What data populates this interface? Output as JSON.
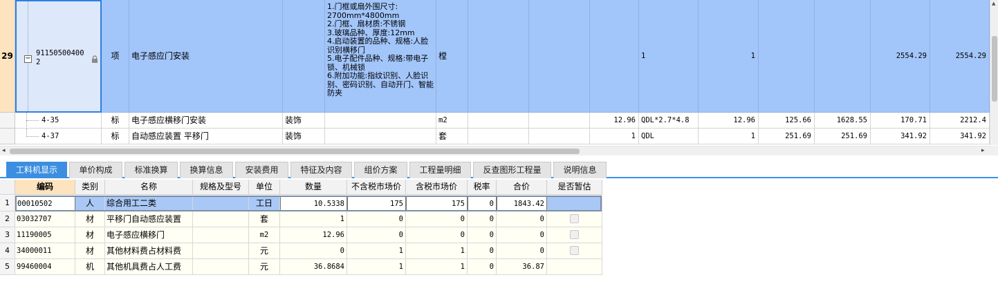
{
  "top_grid": {
    "rows": [
      {
        "row_num": "29",
        "code": "91150500400\n2",
        "type": "项",
        "name": "电子感应门安装",
        "profession": "",
        "features": "1.门框或扇外围尺寸:\n2700mm*4800mm\n2.门框、扇材质:不锈钢\n3.玻璃品种、厚度:12mm\n4.启动装置的品种、规格:人脸识别横移门\n5.电子配件品种、规格:带电子锁、机械锁\n6.附加功能:指纹识别、人脸识别、密码识别、自动开门、智能防夹",
        "unit": "樘",
        "qty_expr": "",
        "qty_unit": "",
        "count": "",
        "expr": "1",
        "quantity": "1",
        "unit_price": "",
        "total": "",
        "c1": "2554.29",
        "c2": "2554.29"
      },
      {
        "row_num": "",
        "code": "4-35",
        "type": "标",
        "name": "电子感应横移门安装",
        "profession": "装饰",
        "features": "",
        "unit": "m2",
        "count": "12.96",
        "expr": "QDL*2.7*4.8",
        "quantity": "12.96",
        "unit_price": "125.66",
        "total": "1628.55",
        "c1": "170.71",
        "c2": "2212.4"
      },
      {
        "row_num": "",
        "code": "4-37",
        "type": "标",
        "name": "自动感应装置 平移门",
        "profession": "装饰",
        "features": "",
        "unit": "套",
        "count": "1",
        "expr": "QDL",
        "quantity": "1",
        "unit_price": "251.69",
        "total": "251.69",
        "c1": "341.92",
        "c2": "341.92"
      }
    ]
  },
  "tabs": [
    "工料机显示",
    "单价构成",
    "标准换算",
    "换算信息",
    "安装费用",
    "特征及内容",
    "组价方案",
    "工程量明细",
    "反查图形工程量",
    "说明信息"
  ],
  "active_tab": "工料机显示",
  "bottom_grid": {
    "headers": [
      "编码",
      "类别",
      "名称",
      "规格及型号",
      "单位",
      "数量",
      "不含税市场价",
      "含税市场价",
      "税率",
      "合价",
      "是否暂估"
    ],
    "rows": [
      {
        "num": "1",
        "code": "00010502",
        "cat": "人",
        "name": "综合用工二类",
        "spec": "",
        "unit": "工日",
        "qty": "10.5338",
        "price_ex": "175",
        "price_in": "175",
        "tax": "0",
        "total": "1843.42",
        "est": false
      },
      {
        "num": "2",
        "code": "03032707",
        "cat": "材",
        "name": "平移门自动感应装置",
        "spec": "",
        "unit": "套",
        "qty": "1",
        "price_ex": "0",
        "price_in": "0",
        "tax": "0",
        "total": "0",
        "est": true
      },
      {
        "num": "3",
        "code": "11190005",
        "cat": "材",
        "name": "电子感应横移门",
        "spec": "",
        "unit": "m2",
        "qty": "12.96",
        "price_ex": "0",
        "price_in": "0",
        "tax": "0",
        "total": "0",
        "est": true
      },
      {
        "num": "4",
        "code": "34000011",
        "cat": "材",
        "name": "其他材料费占材料费",
        "spec": "",
        "unit": "元",
        "qty": "0",
        "price_ex": "1",
        "price_in": "1",
        "tax": "0",
        "total": "0",
        "est": true
      },
      {
        "num": "5",
        "code": "99460004",
        "cat": "机",
        "name": "其他机具费占人工费",
        "spec": "",
        "unit": "元",
        "qty": "36.8684",
        "price_ex": "1",
        "price_in": "1",
        "tax": "0",
        "total": "36.87",
        "est": null
      }
    ]
  },
  "icons": {
    "lock": "lock-icon",
    "collapse": "collapse-minus-icon",
    "scroll_left": "arrow-left-icon",
    "scroll_right": "arrow-right-icon",
    "scroll_up": "arrow-up-icon"
  },
  "colors": {
    "selected_row": "#a2c5fa",
    "active_tab": "#3b8ee0",
    "row_header_active": "#fde3be",
    "detail_cell_bg": "#fffff4"
  }
}
